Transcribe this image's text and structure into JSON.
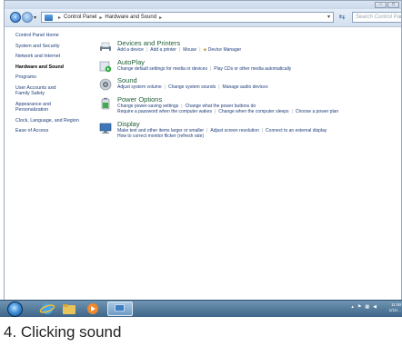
{
  "window": {
    "address": {
      "segments": [
        "Control Panel",
        "Hardware and Sound"
      ],
      "separator": "▸"
    },
    "search_placeholder": "Search Control Panel"
  },
  "sidebar": {
    "items": [
      {
        "label": "Control Panel Home"
      },
      {
        "label": "System and Security"
      },
      {
        "label": "Network and Internet"
      },
      {
        "label": "Hardware and Sound"
      },
      {
        "label": "Programs"
      },
      {
        "label": "User Accounts and Family Safety"
      },
      {
        "label": "Appearance and Personalization"
      },
      {
        "label": "Clock, Language, and Region"
      },
      {
        "label": "Ease of Access"
      }
    ]
  },
  "categories": [
    {
      "title": "Devices and Printers",
      "icon": "printer-icon",
      "lines": [
        [
          "Add a device",
          "Add a printer",
          "Mouse",
          "Device Manager"
        ]
      ]
    },
    {
      "title": "AutoPlay",
      "icon": "autoplay-icon",
      "lines": [
        [
          "Change default settings for media or devices",
          "Play CDs or other media automatically"
        ]
      ]
    },
    {
      "title": "Sound",
      "icon": "speaker-icon",
      "lines": [
        [
          "Adjust system volume",
          "Change system sounds",
          "Manage audio devices"
        ]
      ]
    },
    {
      "title": "Power Options",
      "icon": "battery-icon",
      "lines": [
        [
          "Change power-saving settings",
          "Change what the power buttons do"
        ],
        [
          "Require a password when the computer wakes",
          "Change when the computer sleeps",
          "Choose a power plan"
        ]
      ]
    },
    {
      "title": "Display",
      "icon": "monitor-icon",
      "lines": [
        [
          "Make text and other items larger or smaller",
          "Adjust screen resolution",
          "Connect to an external display"
        ],
        [
          "How to correct monitor flicker (refresh rate)"
        ]
      ]
    }
  ],
  "taskbar": {
    "clock_time": "11:00",
    "clock_date": "1/11/..."
  },
  "caption": "4. Clicking sound",
  "colors": {
    "category_title": "#1e5e35",
    "link": "#1e3d7a",
    "taskbar": "#4f7699"
  }
}
